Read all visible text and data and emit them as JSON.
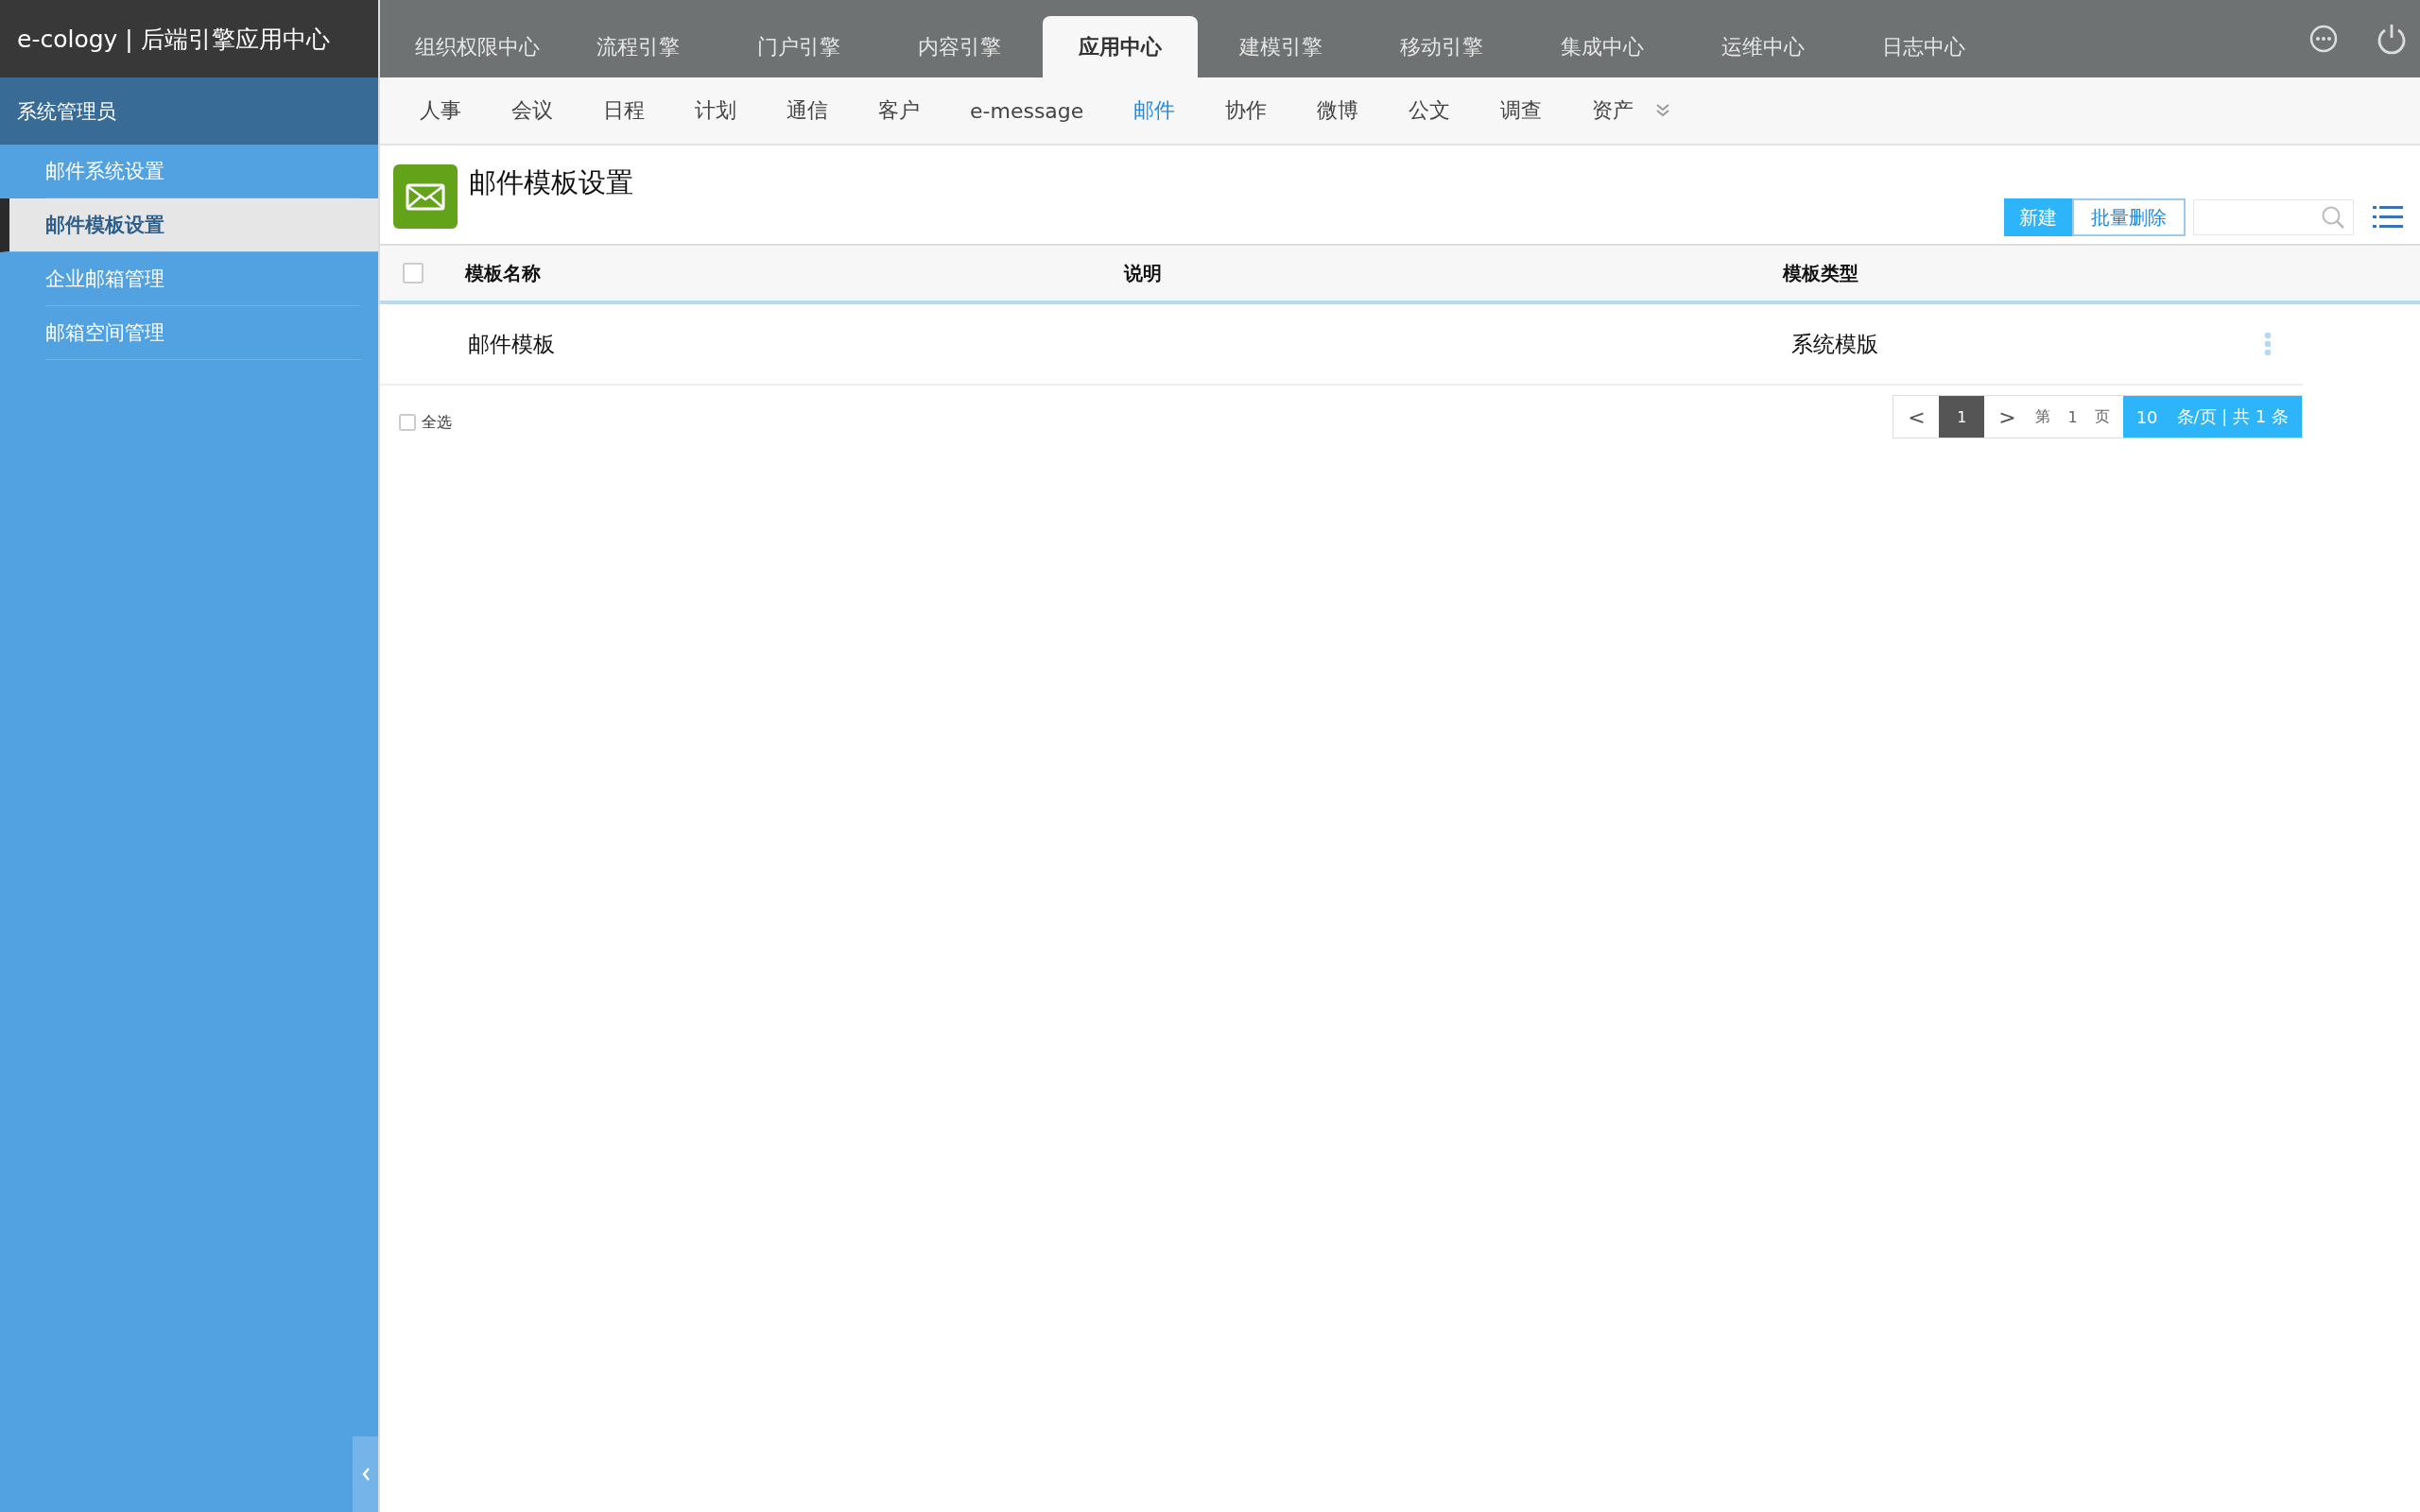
{
  "app_title": "e-cology | 后端引擎应用中心",
  "top_tabs": [
    {
      "label": "组织权限中心",
      "selected": false
    },
    {
      "label": "流程引擎",
      "selected": false
    },
    {
      "label": "门户引擎",
      "selected": false
    },
    {
      "label": "内容引擎",
      "selected": false
    },
    {
      "label": "应用中心",
      "selected": true
    },
    {
      "label": "建模引擎",
      "selected": false
    },
    {
      "label": "移动引擎",
      "selected": false
    },
    {
      "label": "集成中心",
      "selected": false
    },
    {
      "label": "运维中心",
      "selected": false
    },
    {
      "label": "日志中心",
      "selected": false
    }
  ],
  "sidebar": {
    "user": "系统管理员",
    "items": [
      {
        "label": "邮件系统设置",
        "selected": false
      },
      {
        "label": "邮件模板设置",
        "selected": true
      },
      {
        "label": "企业邮箱管理",
        "selected": false
      },
      {
        "label": "邮箱空间管理",
        "selected": false
      }
    ]
  },
  "sub_nav": [
    {
      "label": "人事",
      "selected": false
    },
    {
      "label": "会议",
      "selected": false
    },
    {
      "label": "日程",
      "selected": false
    },
    {
      "label": "计划",
      "selected": false
    },
    {
      "label": "通信",
      "selected": false
    },
    {
      "label": "客户",
      "selected": false
    },
    {
      "label": "e-message",
      "selected": false
    },
    {
      "label": "邮件",
      "selected": true
    },
    {
      "label": "协作",
      "selected": false
    },
    {
      "label": "微博",
      "selected": false
    },
    {
      "label": "公文",
      "selected": false
    },
    {
      "label": "调查",
      "selected": false
    },
    {
      "label": "资产",
      "selected": false
    }
  ],
  "page_title": "邮件模板设置",
  "toolbar": {
    "buttons": [
      "新建",
      "批量删除"
    ]
  },
  "table": {
    "select_all_checked": false,
    "columns": [
      "模板名称",
      "说明",
      "模板类型"
    ],
    "rows": [
      {
        "cells": [
          "邮件模板",
          "",
          "系统模版"
        ]
      }
    ]
  },
  "footer": {
    "select_all_label": "全选",
    "select_all_checked": false
  },
  "pagination": {
    "prev": "<",
    "pages": [
      {
        "label": "1",
        "selected": true
      }
    ],
    "next": ">",
    "page_prefix": "第",
    "page_input": "1",
    "page_suffix": "页",
    "page_size": "10",
    "summary": "条/页 | 共 1 条"
  }
}
